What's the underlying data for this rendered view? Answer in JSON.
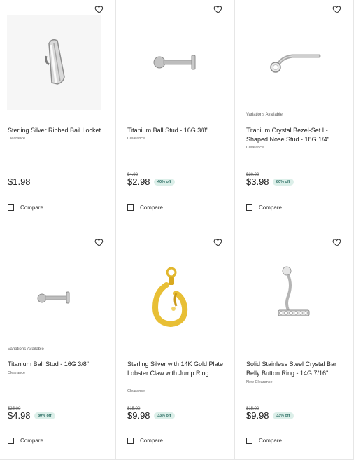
{
  "products": [
    {
      "title": "Sterling Silver Ribbed Bail Locket",
      "tag": "Clearance",
      "variations": "",
      "old_price": "",
      "price": "$1.98",
      "discount": "",
      "compare_label": "Compare"
    },
    {
      "title": "Titanium Ball Stud - 16G 3/8\"",
      "tag": "Clearance",
      "variations": "",
      "old_price": "$4.98",
      "price": "$2.98",
      "discount": "40% off",
      "compare_label": "Compare"
    },
    {
      "title": "Titanium Crystal Bezel-Set L-Shaped Nose Stud - 18G 1/4\"",
      "tag": "Clearance",
      "variations": "Variations Available",
      "old_price": "$20.00",
      "price": "$3.98",
      "discount": "80% off",
      "compare_label": "Compare"
    },
    {
      "title": "Titanium Ball Stud - 16G 3/8\"",
      "tag": "Clearance",
      "variations": "Variations Available",
      "old_price": "$25.00",
      "price": "$4.98",
      "discount": "80% off",
      "compare_label": "Compare"
    },
    {
      "title": "Sterling Silver with 14K Gold Plate Lobster Claw with Jump Ring",
      "tag": "Clearance",
      "variations": "",
      "old_price": "$15.00",
      "price": "$9.98",
      "discount": "33% off",
      "compare_label": "Compare"
    },
    {
      "title": "Solid Stainless Steel Crystal Bar Belly Button Ring - 14G 7/16\"",
      "tag": "New Clearance",
      "variations": "",
      "old_price": "$15.00",
      "price": "$9.98",
      "discount": "33% off",
      "compare_label": "Compare"
    }
  ],
  "icons": {
    "wishlist": "heart-outline-icon",
    "compare": "checkbox-empty-icon"
  },
  "colors": {
    "badge_bg": "#dcefe9",
    "badge_text": "#2b6d63",
    "gold": "#e2b72d",
    "silver": "#b9b9b9"
  }
}
